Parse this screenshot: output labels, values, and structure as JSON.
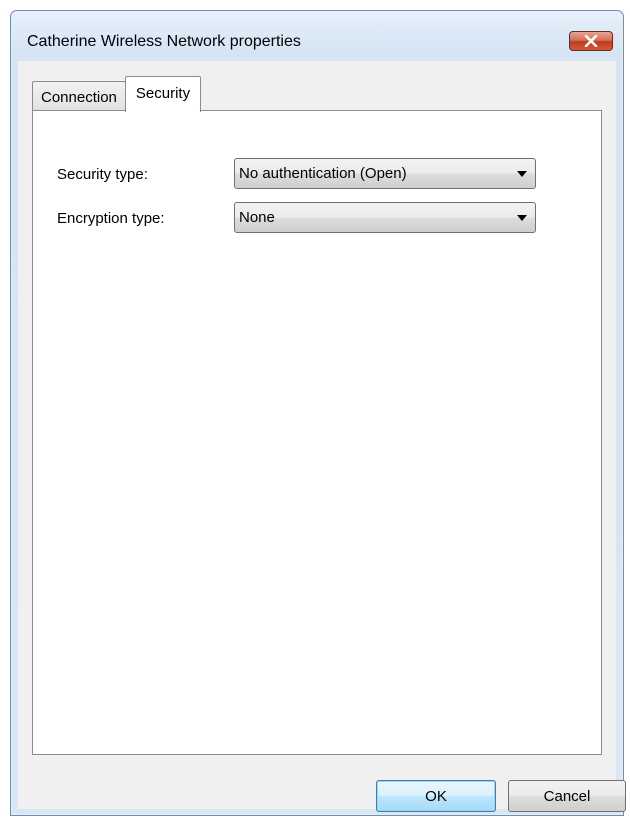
{
  "window": {
    "title": "Catherine Wireless Network properties"
  },
  "tabs": [
    {
      "label": "Connection",
      "selected": false
    },
    {
      "label": "Security",
      "selected": true
    }
  ],
  "security": {
    "security_type_label": "Security type:",
    "security_type_value": "No authentication (Open)",
    "encryption_type_label": "Encryption type:",
    "encryption_type_value": "None"
  },
  "buttons": {
    "ok_label": "OK",
    "cancel_label": "Cancel"
  },
  "icons": {
    "close": "close-icon",
    "dropdown": "chevron-down-icon"
  },
  "colors": {
    "close_button": "#c0391d",
    "title_bar": "#d6e4f4",
    "default_button_border": "#3c7fb1"
  }
}
